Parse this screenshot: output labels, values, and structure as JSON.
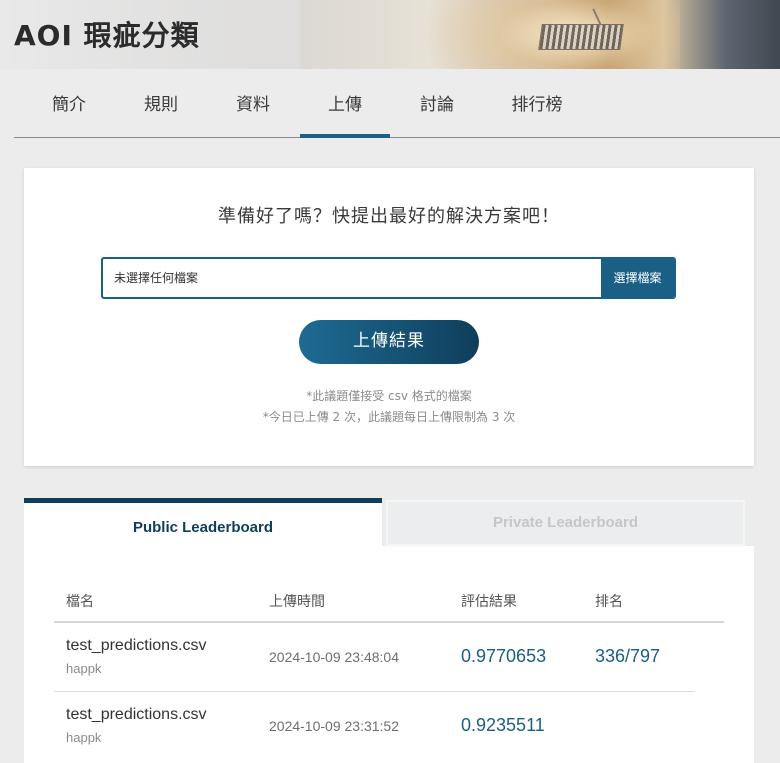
{
  "banner": {
    "title": "AOI 瑕疵分類"
  },
  "nav": {
    "tabs": [
      {
        "label": "簡介"
      },
      {
        "label": "規則"
      },
      {
        "label": "資料"
      },
      {
        "label": "上傳",
        "active": true
      },
      {
        "label": "討論"
      },
      {
        "label": "排行榜"
      }
    ]
  },
  "upload": {
    "prompt": "準備好了嗎？快提出最好的解決方案吧！",
    "file_status": "未選擇任何檔案",
    "choose_label": "選擇檔案",
    "submit_label": "上傳結果",
    "note_format": "*此議題僅接受 csv 格式的檔案",
    "note_limit": "*今日已上傳 2 次，此議題每日上傳限制為 3 次"
  },
  "leaderboard": {
    "tabs": {
      "public": "Public Leaderboard",
      "private": "Private Leaderboard"
    },
    "headers": {
      "file": "檔名",
      "time": "上傳時間",
      "score": "評估結果",
      "rank": "排名"
    },
    "rows": [
      {
        "file": "test_predictions.csv",
        "user": "happk",
        "time": "2024-10-09 23:48:04",
        "score": "0.9770653",
        "rank": "336/797"
      },
      {
        "file": "test_predictions.csv",
        "user": "happk",
        "time": "2024-10-09 23:31:52",
        "score": "0.9235511",
        "rank": ""
      }
    ]
  },
  "colors": {
    "accent": "#1a5f86",
    "accent_dark": "#0f3e5b",
    "page_bg": "#ececec"
  }
}
